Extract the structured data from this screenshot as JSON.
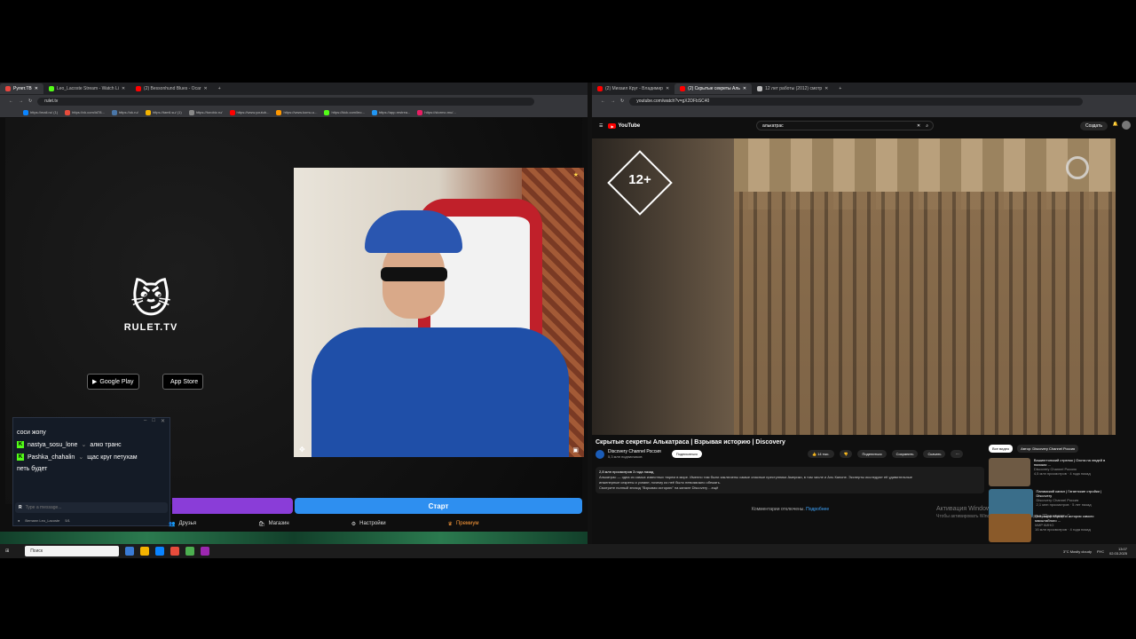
{
  "left_browser": {
    "tabs": [
      {
        "label": "Рулет.ТВ",
        "color": "#e7463f",
        "active": true
      },
      {
        "label": "Leo_Lacoste Stream - Watch Li",
        "color": "#53fc18",
        "active": false
      },
      {
        "label": "(2) Bessonhund Blues - Ocar",
        "color": "#ff0000",
        "active": false
      }
    ],
    "url": "rulet.tv",
    "bookmarks": [
      "https://mail.ru/ (1)",
      "https://vk.com/id78...",
      "https://ok.ru/",
      "https://tamil.su/ (1)",
      "https://torobiz.ru/",
      "https://www.youtub...",
      "https://www.komu.u...",
      "https://kick.com/leo...",
      "https://app.restrea...",
      "https://stormo.mu/..."
    ]
  },
  "rulet": {
    "logo_text": "RULET.TV",
    "google_play": "Google Play",
    "app_store": "App Store",
    "start_button": "Старт",
    "nav": [
      {
        "icon": "friends-icon",
        "label": "Друзья"
      },
      {
        "icon": "shop-icon",
        "label": "Магазин"
      },
      {
        "icon": "gear-icon",
        "label": "Настройки"
      },
      {
        "icon": "premium-icon",
        "label": "Премиум"
      }
    ]
  },
  "chat": {
    "messages": [
      {
        "user": "",
        "text": "соси жопу",
        "kick": false
      },
      {
        "user": "nastya_sosu_lone",
        "text": "алко транс",
        "kick": true
      },
      {
        "user": "Pashka_chahalin",
        "text": "щас круг петухам",
        "kick": true
      },
      {
        "user": "",
        "text": "петь будет",
        "kick": false
      }
    ],
    "input_placeholder": "Type a message...",
    "footer_user": "Bemann Leo_Lacoste",
    "footer_count": "5/1"
  },
  "right_browser": {
    "tabs": [
      {
        "label": "(2) Михаил Круг - Владимир",
        "color": "#ff0000"
      },
      {
        "label": "(2) Скрытые секреты Аль",
        "color": "#ff0000"
      },
      {
        "label": "12 лет работы (2012) смотр",
        "color": "#bbbbbb"
      }
    ],
    "url": "youtube.com/watch?v=gX2DFbSC40",
    "search_query": "алькатрас",
    "create_label": "Создать",
    "logo_text": "YouTube"
  },
  "video": {
    "age_rating": "12+",
    "title": "Скрытые секреты Алькатраса | Взрывая историю | Discovery",
    "channel": "Discovery Channel Россия",
    "subscribers": "5,3 млн подписчиков",
    "subscribe_label": "Подписаться",
    "likes": "14 тыс.",
    "share_label": "Поделиться",
    "save_label": "Сохранить",
    "download_label": "Скачать",
    "description_meta": "2,8 млн просмотров  3 года назад",
    "description_line1": "Алькатрас — одна из самых известных тюрем в мире. Именно там были заключены самые опасные преступники Америки, в том числе и Аль Капоне. Эксперты исследуют её удивительные",
    "description_line2": "инженерные секреты и узнают, почему из неё было невозможно сбежать.",
    "description_line3": "Смотрите полный эпизод \"Взрывая историю\" на канале Discovery  ...ещё",
    "comments_off": "Комментарии отключены.",
    "comments_link": "Подробнее",
    "windows_activation_1": "Активация Windows",
    "windows_activation_2": "Чтобы активировать Windows, перейдите в раздел \"Параметры\"."
  },
  "sidebar": {
    "chips": [
      "Все видео",
      "Автор: Discovery Channel Россия"
    ],
    "recommendations": [
      {
        "title": "Вашингтонский стрелок | Охота на людей в поисках ...",
        "channel": "Discovery Channel Россия",
        "meta": "4,5 млн просмотров · 4 года назад",
        "duration": "44:24",
        "color": "#6e5a44"
      },
      {
        "title": "Панамский канал | Гигантские стройки | Discovery",
        "channel": "Discovery Channel Россия",
        "meta": "2,1 млн просмотров · 5 лет назад",
        "duration": "44:19",
        "color": "#3a6e8a"
      },
      {
        "title": "Операция «Арка» и история самого масштабного ...",
        "channel": "МИР КИНО",
        "meta": "16 млн просмотров · 4 года назад",
        "duration": "",
        "color": "#8a5a2a"
      }
    ]
  },
  "taskbar": {
    "search_placeholder": "Поиск",
    "weather": "3°C  Mostly cloudy",
    "lang": "РУС",
    "time": "13:07",
    "date": "02.03.2025"
  }
}
